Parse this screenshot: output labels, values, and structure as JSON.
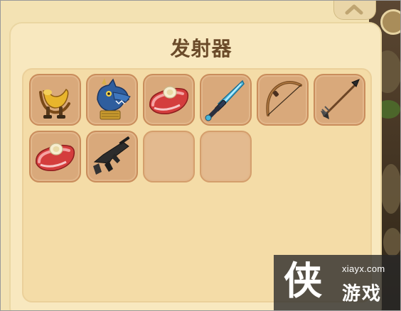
{
  "panel": {
    "title": "发射器"
  },
  "slots": [
    {
      "item": "saddle-icon",
      "filled": true
    },
    {
      "item": "dragon-head-icon",
      "filled": true
    },
    {
      "item": "meat-steak-icon",
      "filled": true
    },
    {
      "item": "crystal-sword-icon",
      "filled": true
    },
    {
      "item": "bow-icon",
      "filled": true
    },
    {
      "item": "arrow-icon",
      "filled": true
    },
    {
      "item": "meat-steak-icon",
      "filled": true
    },
    {
      "item": "submachine-gun-icon",
      "filled": true
    },
    {
      "item": "",
      "filled": false
    },
    {
      "item": "",
      "filled": false
    }
  ],
  "watermark": {
    "logo_char": "侠",
    "url": "xiayx.com",
    "name": "游戏"
  },
  "colors": {
    "parchment": "#f8e8bf",
    "slot_fill": "#d9a97b",
    "title_text": "#6b4b2a"
  }
}
